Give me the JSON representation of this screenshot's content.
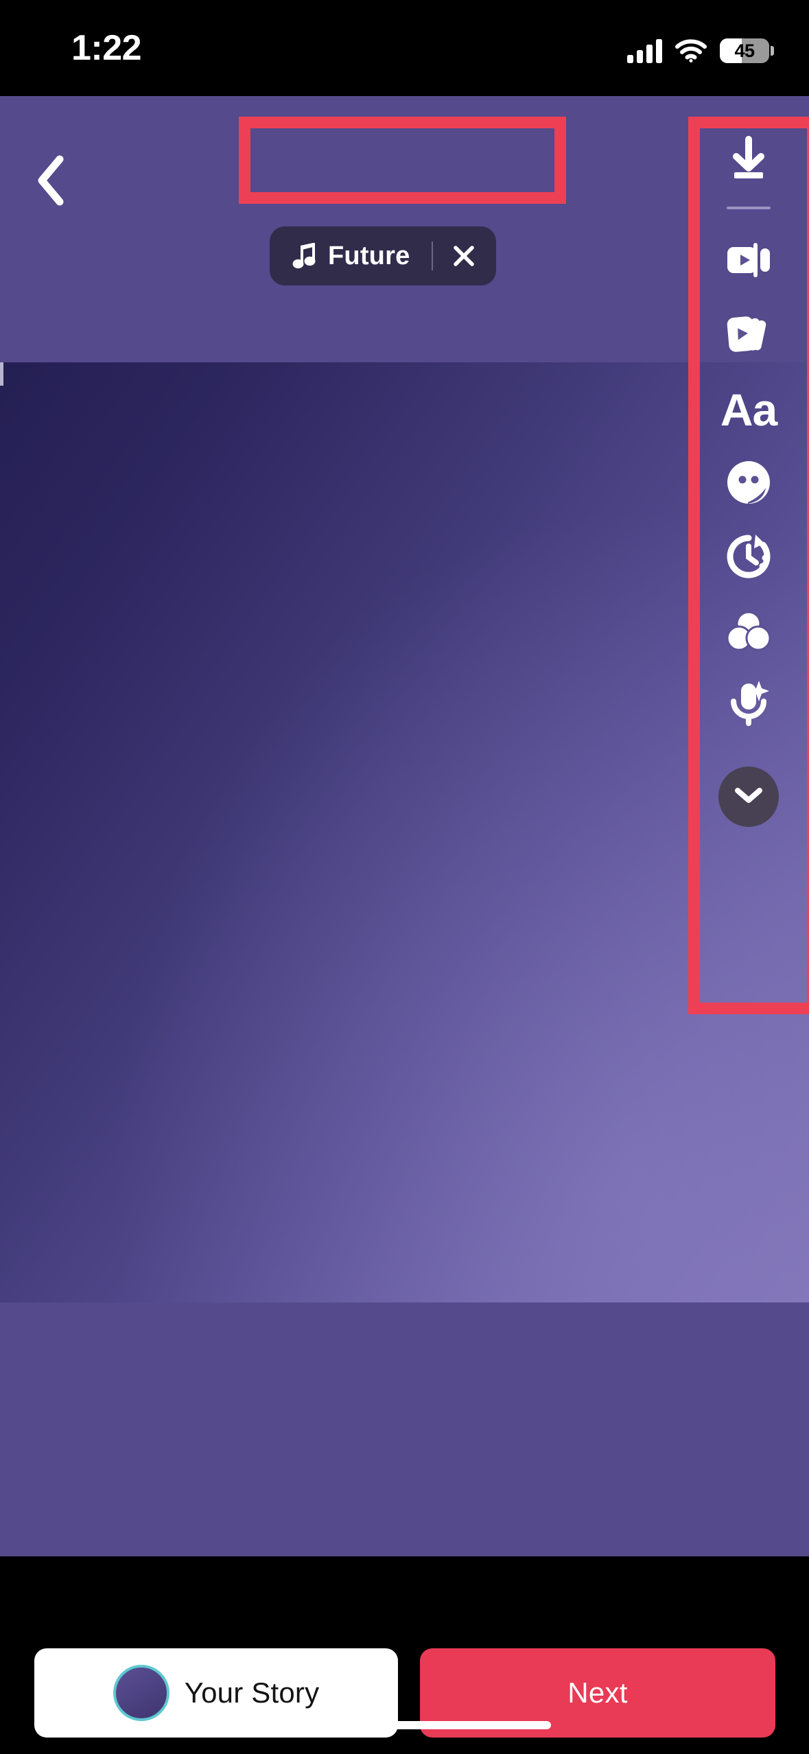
{
  "status_bar": {
    "time": "1:22",
    "cellular_icon": "signal-bars-icon",
    "wifi_icon": "wifi-icon",
    "battery_icon": "battery-icon",
    "battery_percent": "45"
  },
  "header": {
    "back_icon": "chevron-left-icon",
    "music_chip": {
      "note_icon": "music-note-icon",
      "track_title": "Future",
      "close_icon": "close-x-icon"
    }
  },
  "toolbar": {
    "items": [
      {
        "name": "save-to-device",
        "icon": "download-icon"
      },
      {
        "name": "trim-video",
        "icon": "video-trim-icon"
      },
      {
        "name": "layout-cards",
        "icon": "cards-stack-icon"
      },
      {
        "name": "add-text",
        "icon": "text-aa-icon",
        "label": "Aa"
      },
      {
        "name": "add-sticker",
        "icon": "sticker-smiley-icon"
      },
      {
        "name": "set-timer",
        "icon": "timer-clock-icon"
      },
      {
        "name": "apply-filters",
        "icon": "filters-circles-icon"
      },
      {
        "name": "voice-effects",
        "icon": "microphone-sparkle-icon"
      }
    ],
    "more_icon": "chevron-down-icon"
  },
  "annotations": {
    "color": "#EE4055",
    "regions": [
      {
        "name": "music-chip-highlight"
      },
      {
        "name": "toolbar-highlight"
      }
    ]
  },
  "bottom_bar": {
    "your_story_label": "Your Story",
    "avatar_icon": "user-avatar",
    "next_label": "Next",
    "next_color": "#E93A56"
  },
  "canvas": {
    "background_start": "#241F53",
    "background_end": "#7E72B5",
    "letterbox_color": "#544A8C"
  }
}
